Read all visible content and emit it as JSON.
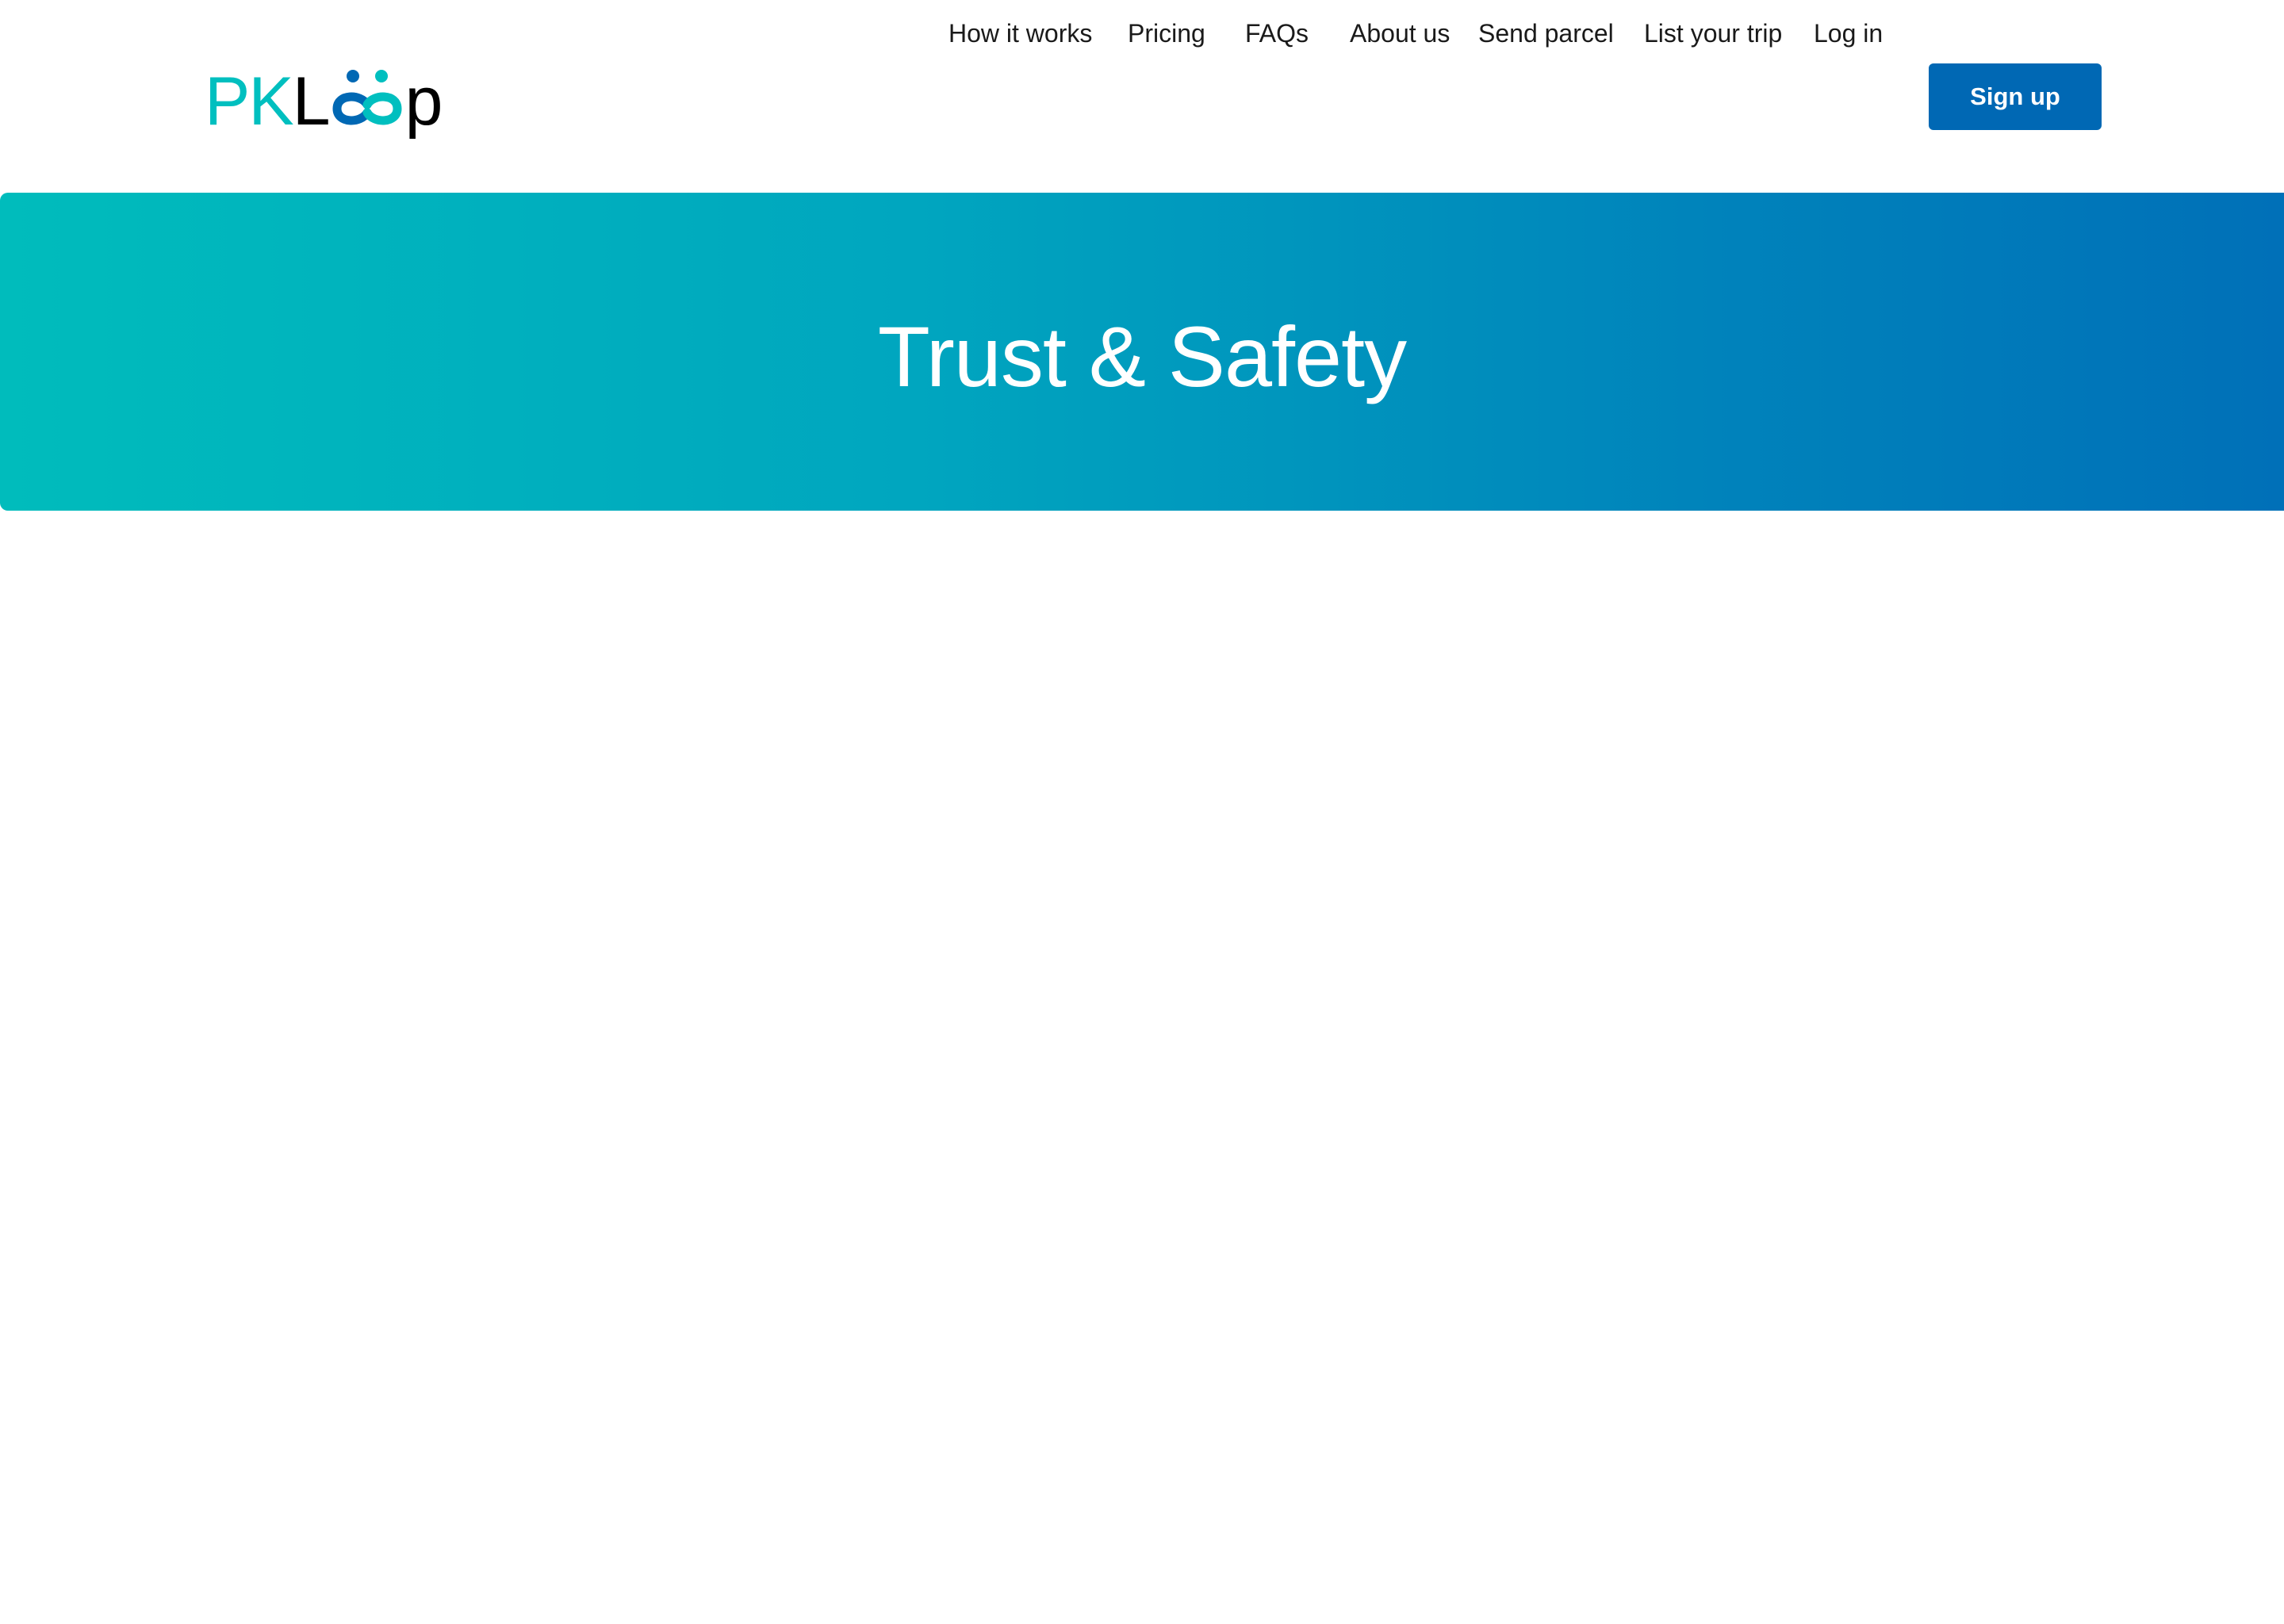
{
  "brand": {
    "name_pk": "PK",
    "name_l": "L",
    "name_p": "p",
    "primary_color": "#00bfbf",
    "accent_color": "#0068b4"
  },
  "nav": {
    "items": [
      {
        "label": "How it works"
      },
      {
        "label": "Pricing"
      },
      {
        "label": "FAQs"
      },
      {
        "label": "About us"
      },
      {
        "label": "Send parcel"
      },
      {
        "label": "List your trip"
      },
      {
        "label": "Log in"
      }
    ],
    "signup_label": "Sign up"
  },
  "hero": {
    "title": "Trust & Safety",
    "gradient_start": "#00bcbc",
    "gradient_end": "#0070b8"
  }
}
